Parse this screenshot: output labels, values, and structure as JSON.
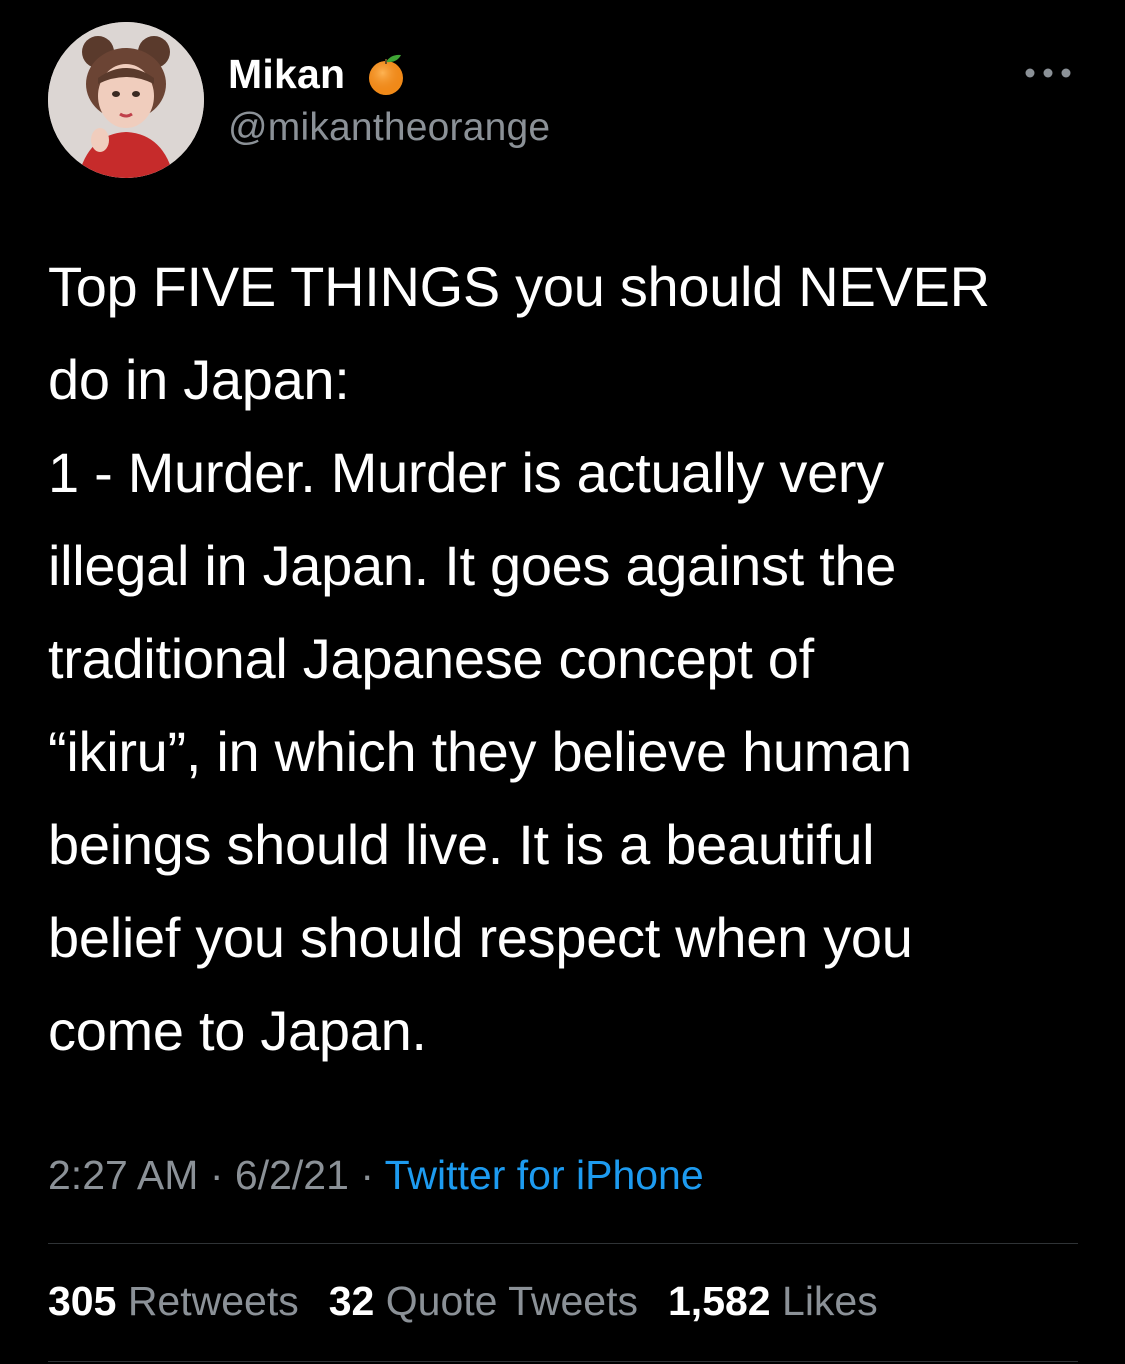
{
  "author": {
    "display_name": "Mikan",
    "handle": "@mikantheorange",
    "avatar_icon": "user-avatar-photo",
    "name_emoji_icon": "tangerine-icon"
  },
  "header": {
    "more_icon": "more-options-icon"
  },
  "tweet": {
    "lines": [
      "Top FIVE THINGS you should NEVER",
      "do in Japan:",
      "1 - Murder. Murder is actually very",
      "illegal in Japan. It goes against the",
      "traditional Japanese concept of",
      "“ikiru”, in which they believe human",
      "beings should live. It is a beautiful",
      "belief you should respect when you",
      "come to Japan."
    ]
  },
  "meta": {
    "time": "2:27 AM",
    "separator": "·",
    "date": "6/2/21",
    "source": "Twitter for iPhone"
  },
  "stats": {
    "retweets_count": "305",
    "retweets_label": "Retweets",
    "quotes_count": "32",
    "quotes_label": "Quote Tweets",
    "likes_count": "1,582",
    "likes_label": "Likes"
  },
  "colors": {
    "background": "#000000",
    "primary_text": "#ffffff",
    "secondary_text": "#8b9197",
    "link": "#1d9bf0",
    "divider": "#2f3336",
    "accent_orange": "#f28c1a"
  }
}
